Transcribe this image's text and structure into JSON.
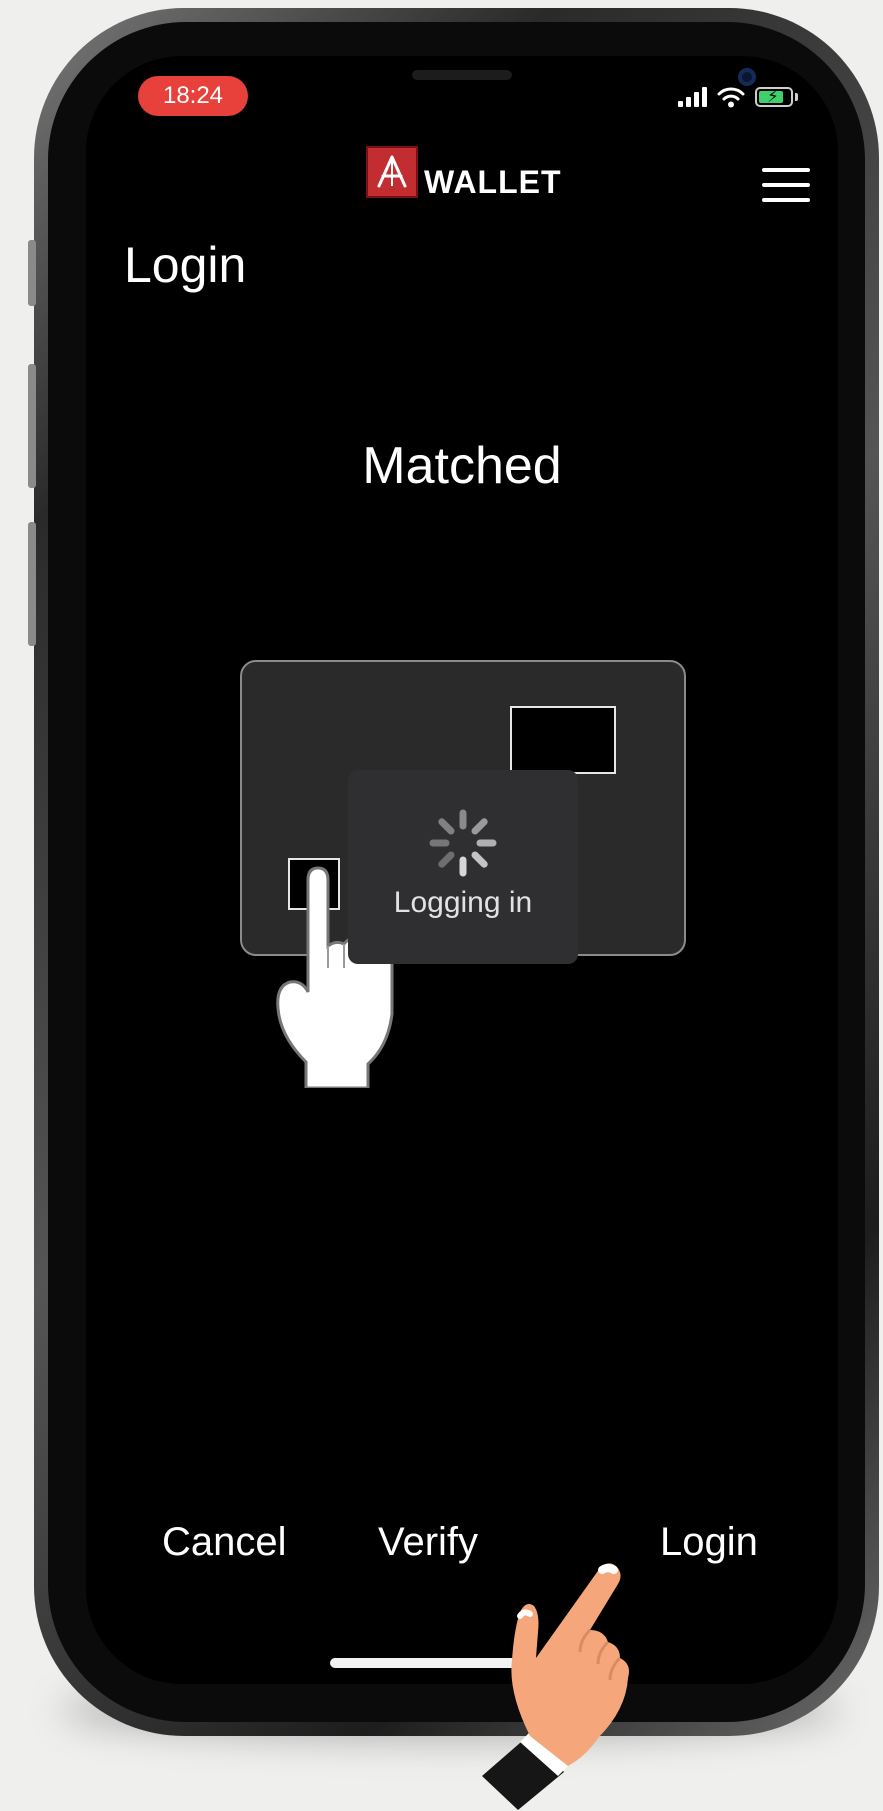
{
  "status_bar": {
    "time": "18:24"
  },
  "header": {
    "logo_text": "WALLET",
    "page_title": "Login"
  },
  "main": {
    "status_text": "Matched",
    "overlay_text": "Logging in"
  },
  "bottom_bar": {
    "cancel_label": "Cancel",
    "verify_label": "Verify",
    "login_label": "Login"
  },
  "colors": {
    "accent": "#e8403a",
    "logo_red": "#c22d32",
    "battery_green": "#3fd06b",
    "screen_bg": "#000000",
    "hand_skin": "#f5a67a"
  },
  "icons": {
    "logo": "wallet-logo-icon",
    "menu": "hamburger-menu-icon",
    "signal": "cellular-signal-icon",
    "wifi": "wifi-icon",
    "battery": "battery-charging-icon",
    "spinner": "loading-spinner-icon",
    "card_hand": "finger-press-icon",
    "tap_hand": "pointing-hand-icon"
  }
}
